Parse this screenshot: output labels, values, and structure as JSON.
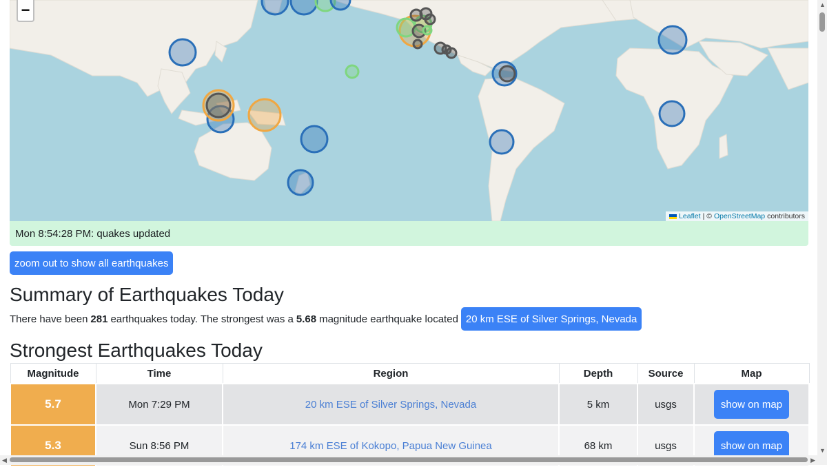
{
  "map": {
    "zoom_out_symbol": "−",
    "attribution": {
      "leaflet": "Leaflet",
      "separator": "| ©",
      "osm": "OpenStreetMap",
      "suffix": "contributors"
    }
  },
  "status": {
    "text": "Mon 8:54:28 PM: quakes updated"
  },
  "zoom_out_button": {
    "label": "zoom out to show all earthquakes"
  },
  "summary": {
    "heading": "Summary of Earthquakes Today",
    "text_before_count": "There have been",
    "count": "281",
    "text_after_count": "earthquakes today. The strongest was a",
    "magnitude": "5.68",
    "text_after_magnitude": "magnitude earthquake located",
    "location_button": "20 km ESE of Silver Springs, Nevada"
  },
  "strongest": {
    "heading": "Strongest Earthquakes Today",
    "columns": [
      "Magnitude",
      "Time",
      "Region",
      "Depth",
      "Source",
      "Map"
    ],
    "rows": [
      {
        "magnitude": "5.7",
        "time": "Mon 7:29 PM",
        "region": "20 km ESE of Silver Springs, Nevada",
        "depth": "5 km",
        "source": "usgs",
        "map_button": "show on map"
      },
      {
        "magnitude": "5.3",
        "time": "Sun 8:56 PM",
        "region": "174 km ESE of Kokopo, Papua New Guinea",
        "depth": "68 km",
        "source": "usgs",
        "map_button": "show on map"
      }
    ]
  },
  "colors": {
    "ocean": "#aad3df",
    "land": "#f2efe9",
    "status_bg": "#d1f5dd",
    "button_blue": "#3b82f6",
    "magnitude_orange": "#f0ad4e",
    "marker_blue": "#2a6fb8",
    "marker_orange": "#f0a742",
    "marker_green": "#7fd67f",
    "marker_gray": "#555555"
  }
}
